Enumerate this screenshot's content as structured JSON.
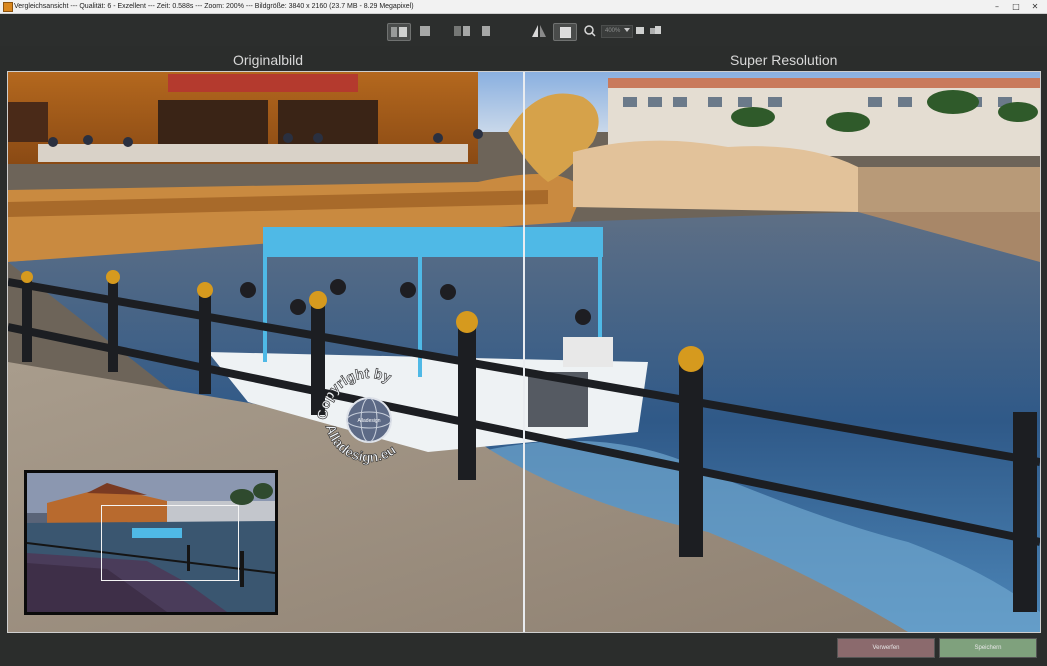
{
  "window": {
    "title": "Vergleichsansicht --- Qualität: 6 - Exzellent --- Zeit: 0.588s --- Zoom: 200% --- Bildgröße: 3840 x 2160 (23.7 MB - 8.29 Megapixel)",
    "minimize": "–",
    "maximize": "□",
    "close": "✕"
  },
  "toolbar": {
    "zoom_value": "400%"
  },
  "panes": {
    "left_label": "Originalbild",
    "right_label": "Super Resolution"
  },
  "watermark": {
    "top_text": "Copyright by",
    "bottom_text": "Alladesign.eu",
    "center_text": "Alladesign"
  },
  "footer": {
    "discard_label": "Verwerfen",
    "save_label": "Speichern"
  },
  "colors": {
    "accent": "#3a3c3b",
    "save": "#7fa17d",
    "discard": "#8b6a6d"
  }
}
